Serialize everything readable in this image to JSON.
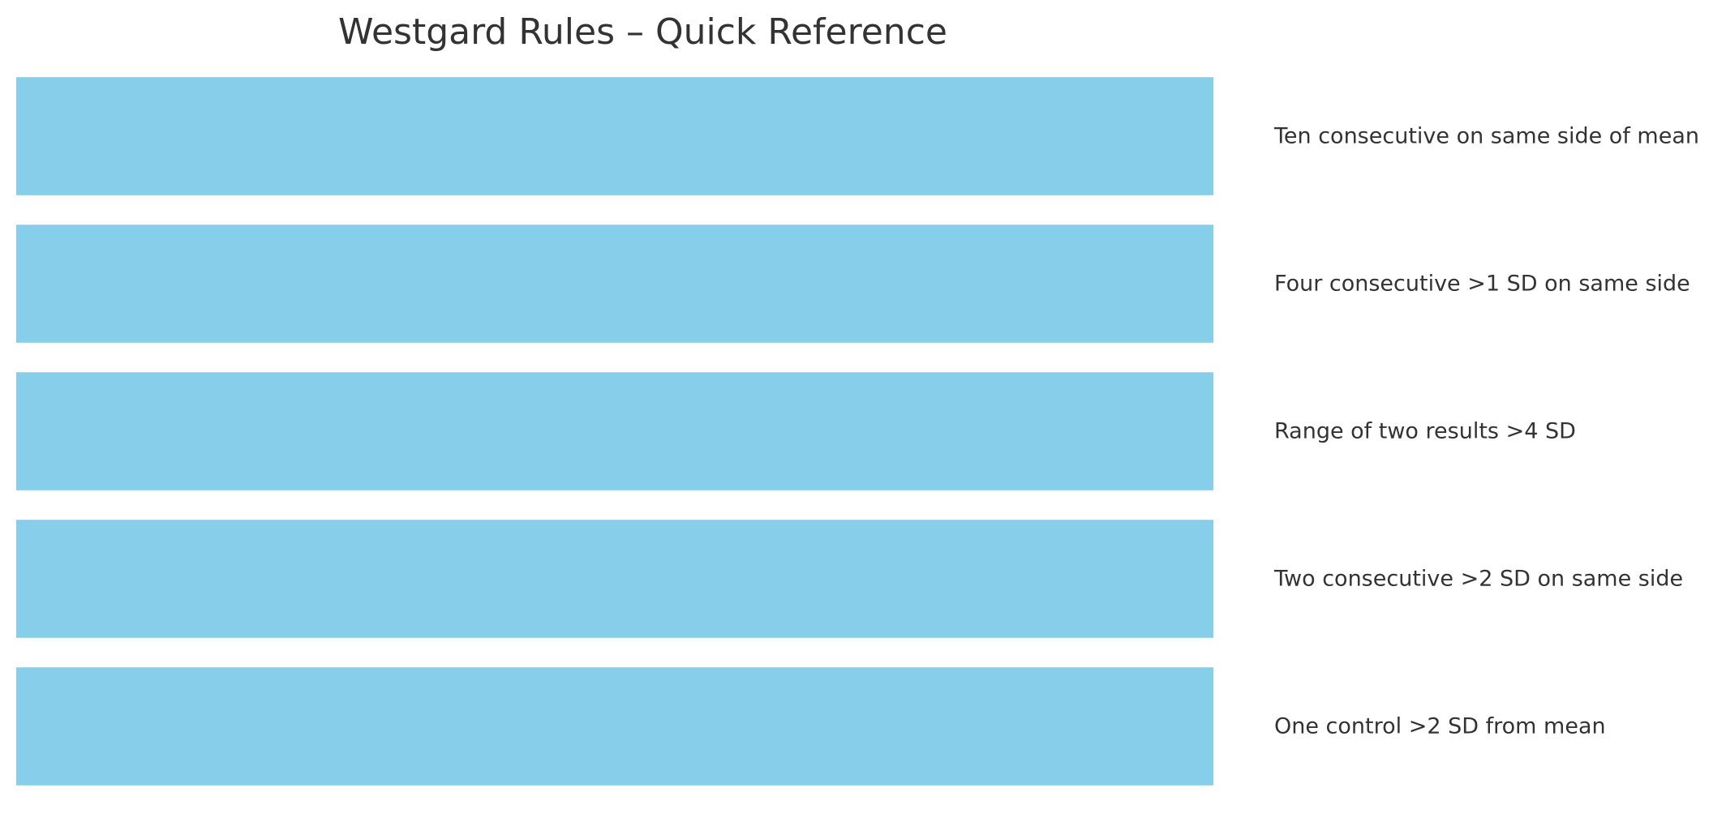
{
  "chart_data": {
    "type": "bar",
    "orientation": "horizontal",
    "title": "Westgard Rules – Quick Reference",
    "xlabel": "",
    "ylabel": "",
    "categories": [
      "Ten consecutive on same side of mean",
      "Four consecutive >1 SD on same side",
      "Range of two results >4 SD",
      "Two consecutive >2 SD on same side",
      "One control >2 SD from mean"
    ],
    "values": [
      1,
      1,
      1,
      1,
      1
    ],
    "xlim": [
      0,
      1
    ],
    "grid": false,
    "axes_visible": false,
    "legend": "none"
  },
  "colors": {
    "bar": "#87CEEB",
    "text": "#333333"
  }
}
